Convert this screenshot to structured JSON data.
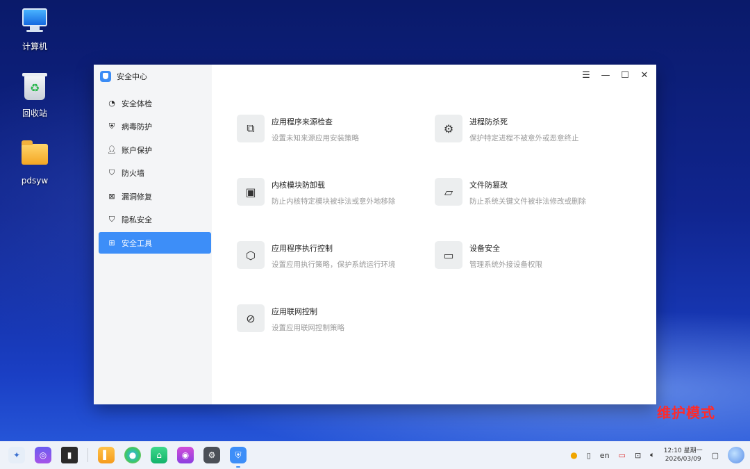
{
  "desktop": {
    "icons": [
      {
        "label": "计算机",
        "icon": "computer-icon"
      },
      {
        "label": "回收站",
        "icon": "trash-icon"
      },
      {
        "label": "pdsyw",
        "icon": "folder-icon"
      }
    ]
  },
  "window": {
    "title": "安全中心",
    "controls": [
      "menu-icon",
      "minimize-icon",
      "maximize-icon",
      "close-icon"
    ],
    "nav": [
      {
        "label": "安全体检",
        "icon": "scan-icon",
        "active": false
      },
      {
        "label": "病毒防护",
        "icon": "shield-plus-icon",
        "active": false
      },
      {
        "label": "账户保护",
        "icon": "user-icon",
        "active": false
      },
      {
        "label": "防火墙",
        "icon": "firewall-icon",
        "active": false
      },
      {
        "label": "漏洞修复",
        "icon": "bug-fix-icon",
        "active": false
      },
      {
        "label": "隐私安全",
        "icon": "privacy-shield-icon",
        "active": false
      },
      {
        "label": "安全工具",
        "icon": "grid-icon",
        "active": true
      }
    ],
    "tools": [
      {
        "title": "应用程序来源检查",
        "desc": "设置未知来源应用安装策略",
        "icon": "app-source-icon"
      },
      {
        "title": "进程防杀死",
        "desc": "保护特定进程不被意外或恶意终止",
        "icon": "process-icon"
      },
      {
        "title": "内核模块防卸载",
        "desc": "防止内核特定模块被非法或意外地移除",
        "icon": "chip-icon"
      },
      {
        "title": "文件防篡改",
        "desc": "防止系统关键文件被非法修改或删除",
        "icon": "folder-lock-icon"
      },
      {
        "title": "应用程序执行控制",
        "desc": "设置应用执行策略，保护系统运行环境",
        "icon": "exec-control-icon"
      },
      {
        "title": "设备安全",
        "desc": "管理系统外接设备权限",
        "icon": "device-monitor-icon"
      },
      {
        "title": "应用联网控制",
        "desc": "设置应用联网控制策略",
        "icon": "network-planet-icon"
      }
    ]
  },
  "watermark": "维护模式",
  "taskbar": {
    "apps": [
      "launcher-icon",
      "search-app-icon",
      "multitask-icon",
      "file-manager-icon",
      "browser-icon",
      "app-store-icon",
      "camera-icon",
      "settings-icon",
      "security-center-icon"
    ],
    "tray": {
      "lang": "en",
      "time": "12:10 星期一",
      "date": "2026/03/09"
    }
  }
}
